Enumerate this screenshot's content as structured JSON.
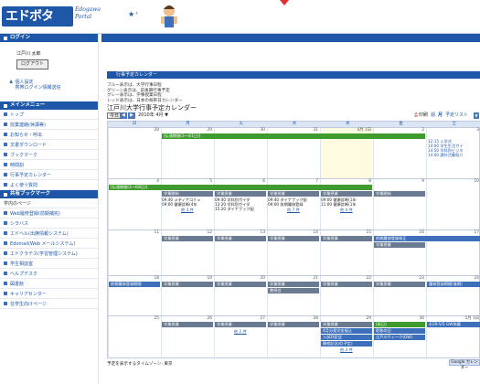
{
  "header": {
    "logo": "エドボタ",
    "logo_sub": "Edogawa\nPortal"
  },
  "sidebar": {
    "login_title": "ログイン",
    "user_name": "江戸川 太郎",
    "logout_label": "ログアウト",
    "setting_label": "個人設定\n携帯ログイン情報送信",
    "main_menu_title": "メインメニュー",
    "main_items": [
      "トップ",
      "授業連絡(休講等)",
      "お知らせ・呼出",
      "文書ダウンロード",
      "ブックマーク",
      "時間割",
      "行事予定カレンダー",
      "よく使う質問"
    ],
    "shared_bookmark_title": "共有ブックマーク",
    "shared_sub": "学内のページ",
    "shared_items": [
      "Web履修登録(前期補完)",
      "シラバス",
      "エドヘル(出席情報システム)",
      "Edomail(Web メールシステム)",
      "エドクラテス(学習管理システム)",
      "学生相談室",
      "ヘルプデスク",
      "図書館",
      "キャリアセンター",
      "在学生向けページ"
    ]
  },
  "panel_title": "行事予定カレンダー",
  "legend": [
    "ブルー表示は、大学行事日程",
    "グリーン表示は、前後期行事予定",
    "グレー表示は、学事授業日程",
    "レッド表示は、日本の祝祭日カレンダー"
  ],
  "calendar": {
    "title": "江戸川大学行事予定カレンダー",
    "today_btn": "今日",
    "month_label": "2010年 4月 ▼",
    "print_label": "印刷",
    "week_label": "週",
    "month_view_label": "月",
    "agenda_label": "予定リスト",
    "daynames": [
      "日",
      "月",
      "火",
      "水",
      "木",
      "金",
      "土"
    ],
    "weeks": [
      {
        "days": [
          "28",
          "29",
          "30",
          "31",
          "4月 1日",
          "2",
          "3"
        ]
      },
      {
        "days": [
          "4",
          "5",
          "6",
          "7",
          "8",
          "9",
          "10"
        ]
      },
      {
        "days": [
          "11",
          "12",
          "13",
          "14",
          "15",
          "16",
          "17"
        ]
      },
      {
        "days": [
          "18",
          "19",
          "20",
          "21",
          "22",
          "23",
          "24"
        ]
      },
      {
        "days": [
          "25",
          "26",
          "27",
          "28",
          "29",
          "30",
          "5月 1日"
        ]
      }
    ],
    "week1_bar": "[伝達期間(3~4/1日)]",
    "week1_sat": [
      "12:15 入学式",
      "14:00 学生生活ガイ",
      "14:50 学科別ビジネ",
      "14:00 課外活動紹介"
    ],
    "week2_bar": "[伝達期間(3~4/8日)]",
    "week2_row": [
      "学業開始",
      "学業授業",
      "学業授業",
      "学業授業",
      "学業開始"
    ],
    "week2_mon": [
      "09:40 メディアコミュ",
      "09:00 健康診断(4年"
    ],
    "week2_tue": [
      "09:40 学科別ガイダ",
      "13:20 学科別ガイダ",
      "15:20 ダイナブック配"
    ],
    "week2_wed": [
      "09:40 ダイナブック配",
      "09:00 前期履修登録"
    ],
    "week2_thu": [
      "09:00 健康診断(1年",
      "11:00 健康診断(1年"
    ],
    "week2_more": [
      "他 3 件",
      "他 7 件",
      "他 4 件"
    ],
    "week3_row": [
      "学業授業",
      "学業授業",
      "学業授業",
      "学業授業",
      "学業授業"
    ],
    "week3_fri": "前期履修登録修正",
    "week4_bar": "前期履修登録期間",
    "week4_row": [
      "学業授業",
      "学業授業",
      "学業授業",
      "学業授業",
      "学業授業"
    ],
    "week4_wed": "教授会",
    "week4_sat": "履修登録期間(後期)",
    "week5_row": [
      "学業授業",
      "学業授業",
      "学業授業",
      "学業授業"
    ],
    "week5_thu": [
      "4月分奨学金振込",
      "入試判定会",
      "開校記念式(予定)"
    ],
    "week5_fri": [
      "[祝日]",
      "昭和の日",
      "江戸川ウィーク(GW)"
    ],
    "week5_sat": "4/29-5/5 GW休講",
    "week5_more": "他 3 件",
    "week5_tue_more": "他 2 件"
  },
  "timezone": "予定を表示するタイムゾーン: 東京",
  "gcal": "Google カレンダー"
}
